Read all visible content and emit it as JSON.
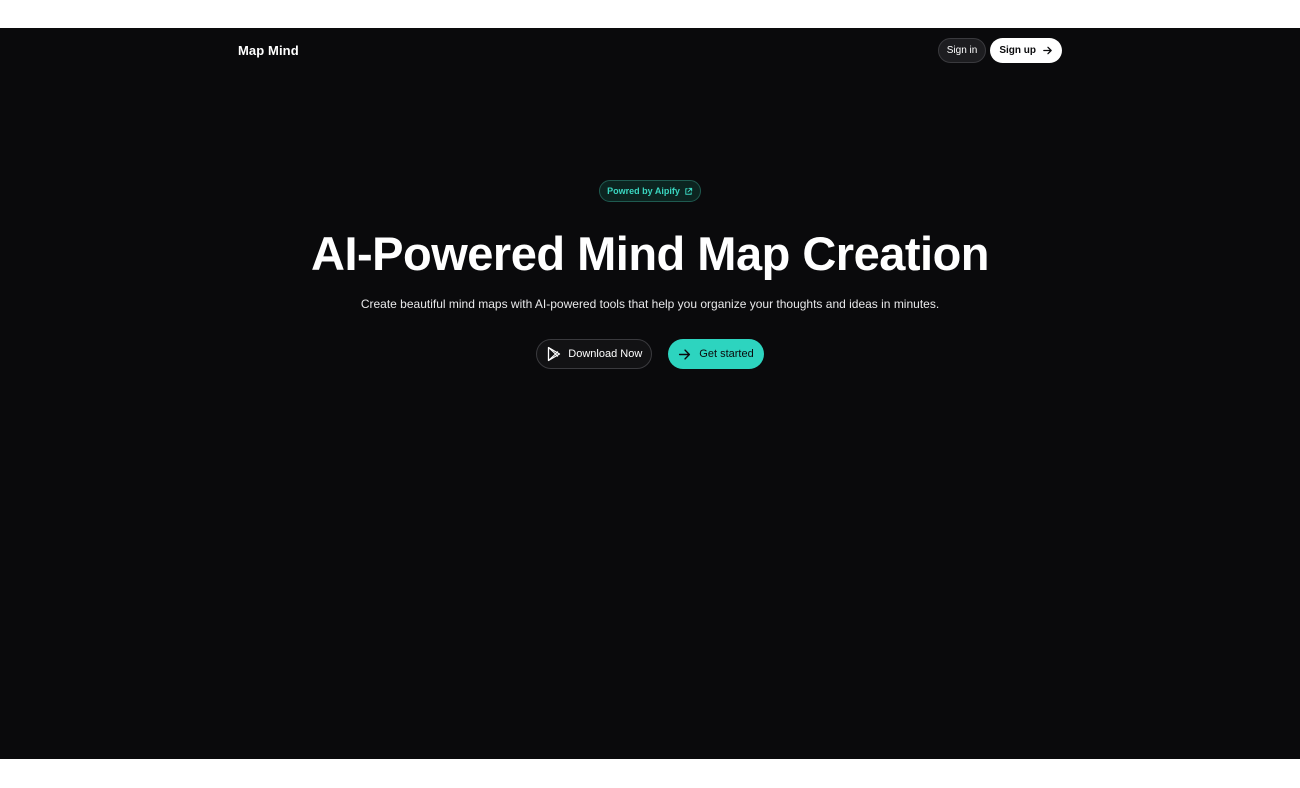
{
  "nav": {
    "brand": "Map Mind",
    "sign_in_label": "Sign in",
    "sign_up_label": "Sign up",
    "sign_up_icon": "arrow-right-icon"
  },
  "hero": {
    "badge_label": "Powred by Aipify",
    "badge_icon": "external-link-icon",
    "headline": "AI-Powered Mind Map Creation",
    "subhead": "Create beautiful mind maps with AI-powered tools that help you organize your thoughts and ideas in minutes.",
    "download_label": "Download Now",
    "download_icon": "google-play-icon",
    "get_started_label": "Get started",
    "get_started_icon": "arrow-right-icon"
  },
  "colors": {
    "background": "#0a0a0c",
    "accent": "#2dd4bf",
    "badge_text": "#3ad6c0"
  }
}
